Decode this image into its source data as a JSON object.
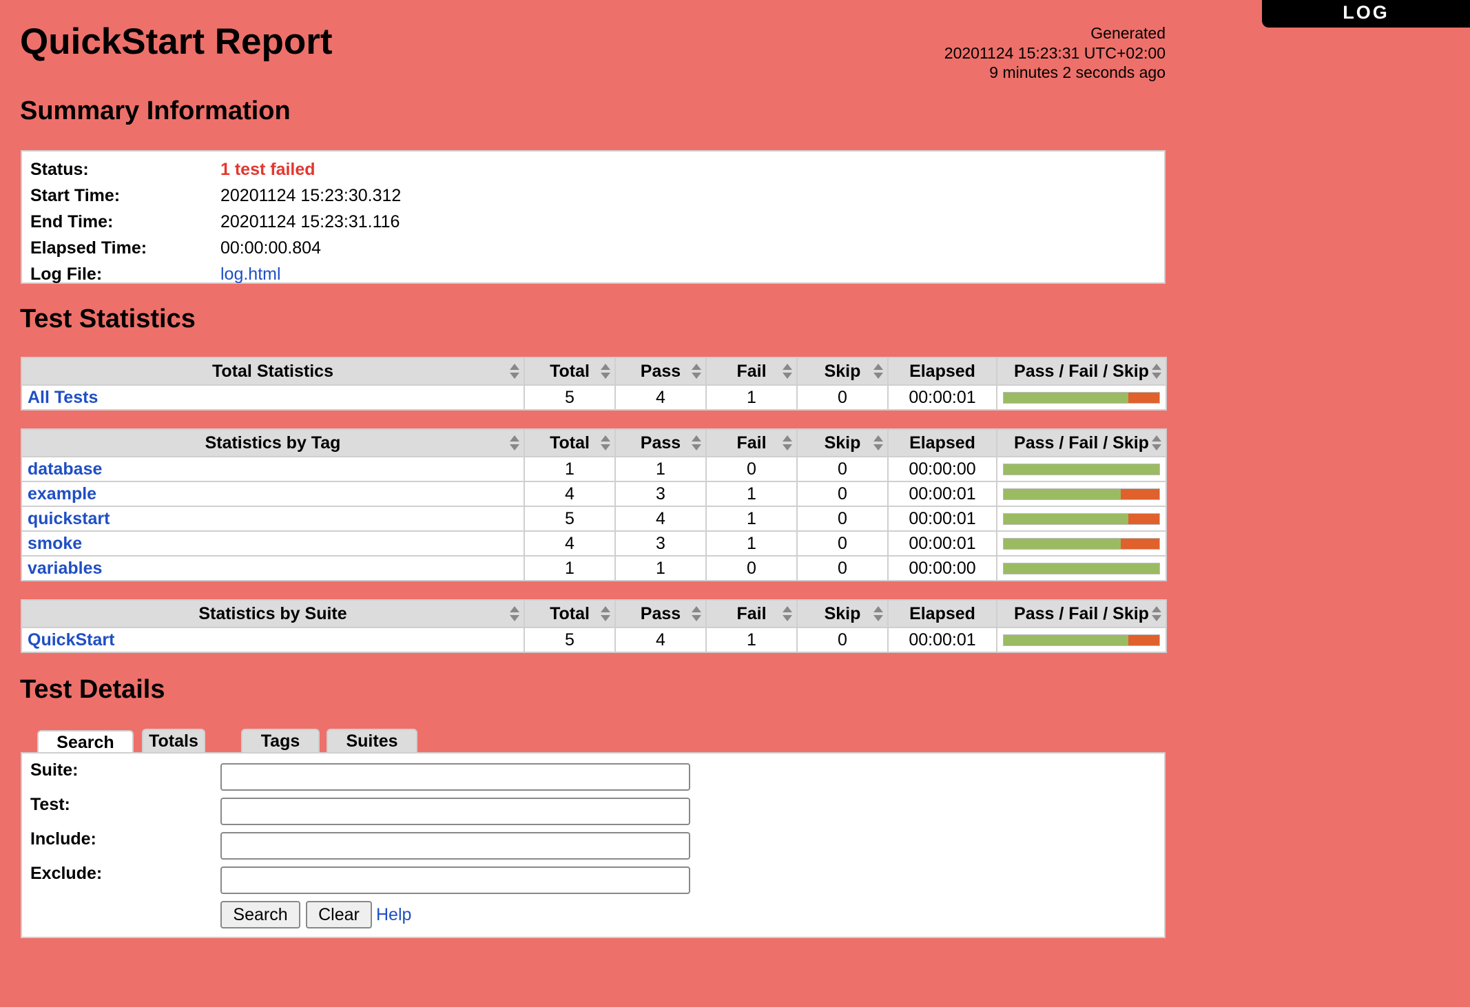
{
  "log_button": "LOG",
  "title": "QuickStart Report",
  "generated": {
    "label": "Generated",
    "timestamp": "20201124 15:23:31 UTC+02:00",
    "ago": "9 minutes 2 seconds ago"
  },
  "summary": {
    "heading": "Summary Information",
    "rows": [
      {
        "label": "Status:",
        "value": "1 test failed"
      },
      {
        "label": "Start Time:",
        "value": "20201124 15:23:30.312"
      },
      {
        "label": "End Time:",
        "value": "20201124 15:23:31.116"
      },
      {
        "label": "Elapsed Time:",
        "value": "00:00:00.804"
      },
      {
        "label": "Log File:",
        "value": "log.html"
      }
    ]
  },
  "statistics": {
    "heading": "Test Statistics",
    "columns": [
      "Total",
      "Pass",
      "Fail",
      "Skip",
      "Elapsed",
      "Pass / Fail / Skip"
    ],
    "total": {
      "title": "Total Statistics",
      "rows": [
        {
          "name": "All Tests",
          "total": "5",
          "pass": "4",
          "fail": "1",
          "skip": "0",
          "elapsed": "00:00:01"
        }
      ]
    },
    "tag": {
      "title": "Statistics by Tag",
      "rows": [
        {
          "name": "database",
          "total": "1",
          "pass": "1",
          "fail": "0",
          "skip": "0",
          "elapsed": "00:00:00"
        },
        {
          "name": "example",
          "total": "4",
          "pass": "3",
          "fail": "1",
          "skip": "0",
          "elapsed": "00:00:01"
        },
        {
          "name": "quickstart",
          "total": "5",
          "pass": "4",
          "fail": "1",
          "skip": "0",
          "elapsed": "00:00:01"
        },
        {
          "name": "smoke",
          "total": "4",
          "pass": "3",
          "fail": "1",
          "skip": "0",
          "elapsed": "00:00:01"
        },
        {
          "name": "variables",
          "total": "1",
          "pass": "1",
          "fail": "0",
          "skip": "0",
          "elapsed": "00:00:00"
        }
      ]
    },
    "suite": {
      "title": "Statistics by Suite",
      "rows": [
        {
          "name": "QuickStart",
          "total": "5",
          "pass": "4",
          "fail": "1",
          "skip": "0",
          "elapsed": "00:00:01"
        }
      ]
    }
  },
  "details": {
    "heading": "Test Details",
    "tabs": [
      "Search",
      "Totals",
      "Tags",
      "Suites"
    ],
    "active_tab": "Search",
    "fields": [
      {
        "label": "Suite:",
        "value": ""
      },
      {
        "label": "Test:",
        "value": ""
      },
      {
        "label": "Include:",
        "value": ""
      },
      {
        "label": "Exclude:",
        "value": ""
      }
    ],
    "search_button": "Search",
    "clear_button": "Clear",
    "help_link": "Help"
  },
  "colors": {
    "background": "#ee706a",
    "pass": "#9bbb63",
    "fail": "#e0612c",
    "skip": "#f8f871",
    "link": "#1f4fc4"
  }
}
